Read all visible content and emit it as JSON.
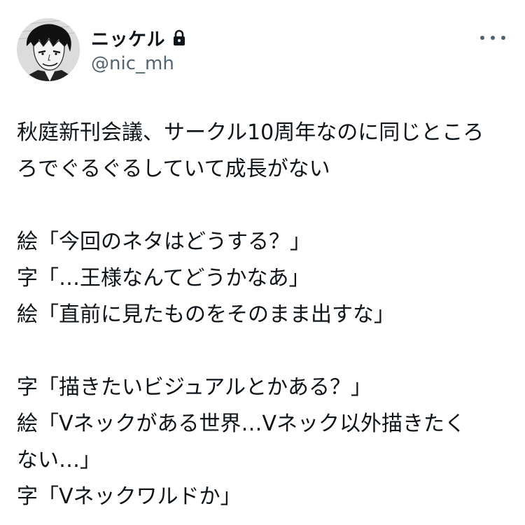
{
  "user": {
    "display_name": "ニッケル",
    "handle": "@nic_mh",
    "protected_icon": "lock-icon",
    "avatar_icon": "manga-avatar"
  },
  "more_menu": {
    "icon": "more-horizontal-icon"
  },
  "tweet": {
    "lines": [
      "秋庭新刊会議、サークル10周年なのに同じところ",
      "ろでぐるぐるしていて成長がない",
      "",
      "絵「今回のネタはどうする？」",
      "字「…王様なんてどうかなあ」",
      "絵「直前に見たものをそのまま出すな」",
      "",
      "字「描きたいビジュアルとかある？」",
      "絵「Vネックがある世界…Vネック以外描きたく",
      "ない…」",
      "字「Vネックワルドか」"
    ]
  },
  "colors": {
    "text": "#0f1419",
    "secondary": "#536471",
    "background": "#ffffff"
  }
}
